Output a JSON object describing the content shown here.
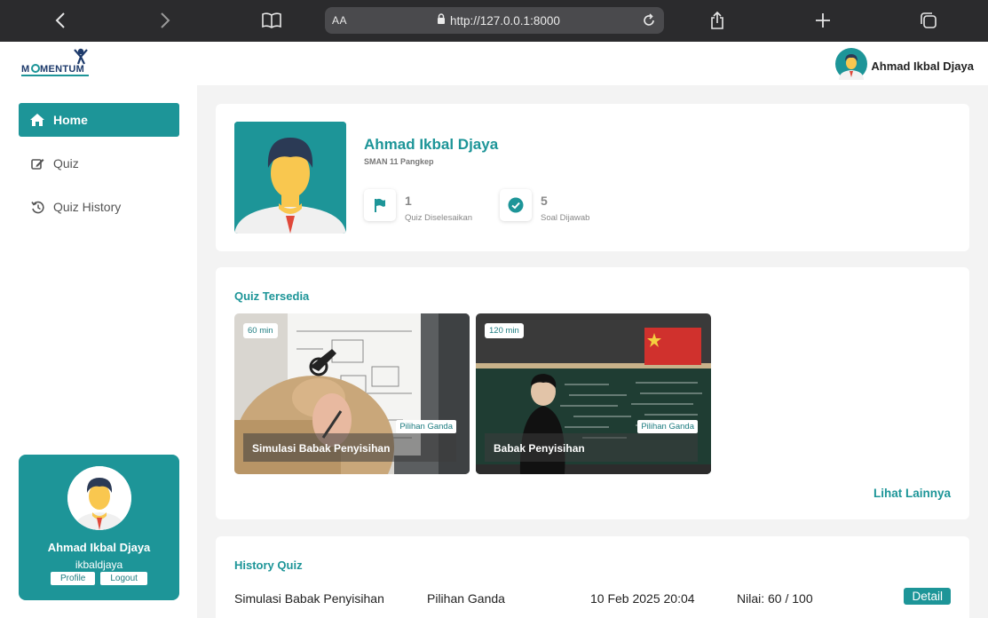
{
  "browser": {
    "text_size_label": "AA",
    "url": "http://127.0.0.1:8000"
  },
  "header": {
    "logo_text": "MOMENTUM",
    "user_name": "Ahmad Ikbal Djaya"
  },
  "sidebar": {
    "items": [
      {
        "label": "Home",
        "icon": "home-icon",
        "active": true
      },
      {
        "label": "Quiz",
        "icon": "edit-icon",
        "active": false
      },
      {
        "label": "Quiz History",
        "icon": "history-icon",
        "active": false
      }
    ],
    "profile": {
      "name": "Ahmad Ikbal Djaya",
      "username": "ikbaldjaya",
      "profile_label": "Profile",
      "logout_label": "Logout"
    }
  },
  "profile_card": {
    "name": "Ahmad Ikbal Djaya",
    "school": "SMAN 11 Pangkep",
    "stats": [
      {
        "value": "1",
        "label": "Quiz Diselesaikan",
        "icon": "flag-icon"
      },
      {
        "value": "5",
        "label": "Soal Dijawab",
        "icon": "check-circle-icon"
      }
    ]
  },
  "quiz_section": {
    "title": "Quiz Tersedia",
    "quizzes": [
      {
        "title": "Simulasi Babak Penyisihan",
        "duration": "60 min",
        "type": "Pilihan Ganda"
      },
      {
        "title": "Babak Penyisihan",
        "duration": "120 min",
        "type": "Pilihan Ganda"
      }
    ],
    "see_more_label": "Lihat Lainnya"
  },
  "history_section": {
    "title": "History Quiz",
    "rows": [
      {
        "quiz": "Simulasi Babak Penyisihan",
        "type": "Pilihan Ganda",
        "date": "10 Feb 2025 20:04",
        "score": "Nilai: 60 / 100",
        "action": "Detail"
      }
    ]
  },
  "colors": {
    "accent": "#1d9598",
    "browser_bar": "#2b2b2d",
    "page_bg": "#f3f3f3"
  }
}
